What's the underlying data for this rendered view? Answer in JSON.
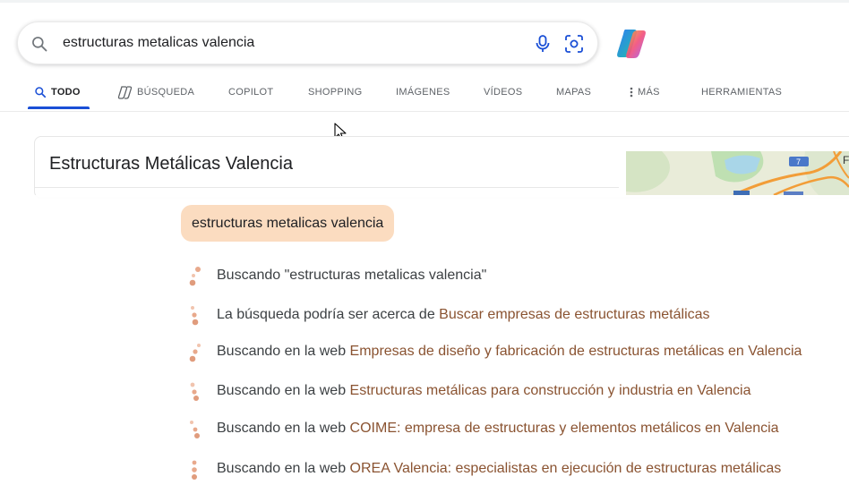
{
  "search": {
    "query": "estructuras metalicas valencia"
  },
  "tabs": [
    {
      "label": "TODO",
      "active": true
    },
    {
      "label": "BÚSQUEDA"
    },
    {
      "label": "COPILOT"
    },
    {
      "label": "SHOPPING"
    },
    {
      "label": "IMÁGENES"
    },
    {
      "label": "VÍDEOS"
    },
    {
      "label": "MAPAS"
    },
    {
      "label": "MÁS"
    },
    {
      "label": "HERRAMIENTAS"
    }
  ],
  "knowledge_card": {
    "title": "Estructuras Metálicas Valencia",
    "map_route_badge": "7",
    "map_corner_letter": "F"
  },
  "copilot": {
    "user_query": "estructuras metalicas valencia",
    "steps": [
      {
        "prefix": "Buscando \"estructuras metalicas valencia\"",
        "link": ""
      },
      {
        "prefix": "La búsqueda podría ser acerca de ",
        "link": "Buscar empresas de estructuras metálicas"
      },
      {
        "prefix": "Buscando en la web ",
        "link": "Empresas de diseño y fabricación de estructuras metálicas en Valencia"
      },
      {
        "prefix": "Buscando en la web ",
        "link": "Estructuras metálicas para construcción y industria en Valencia"
      },
      {
        "prefix": "Buscando en la web ",
        "link": "COIME: empresa de estructuras y elementos metálicos en Valencia"
      },
      {
        "prefix": "Buscando en la web ",
        "link": "OREA Valencia: especialistas en ejecución de estructuras metálicas"
      }
    ]
  },
  "colors": {
    "accent_blue": "#1a4fd6",
    "query_bubble": "#fbdcc0",
    "step_link": "#8a5331",
    "progress_dot": "#e8a98c"
  },
  "icons": {
    "search": "search-icon",
    "mic": "microphone-icon",
    "lens": "visual-search-icon",
    "copilot": "copilot-logo-icon",
    "tab_todo": "search-icon",
    "tab_busqueda": "copilot-search-icon",
    "tab_mas": "vertical-dots-icon"
  }
}
